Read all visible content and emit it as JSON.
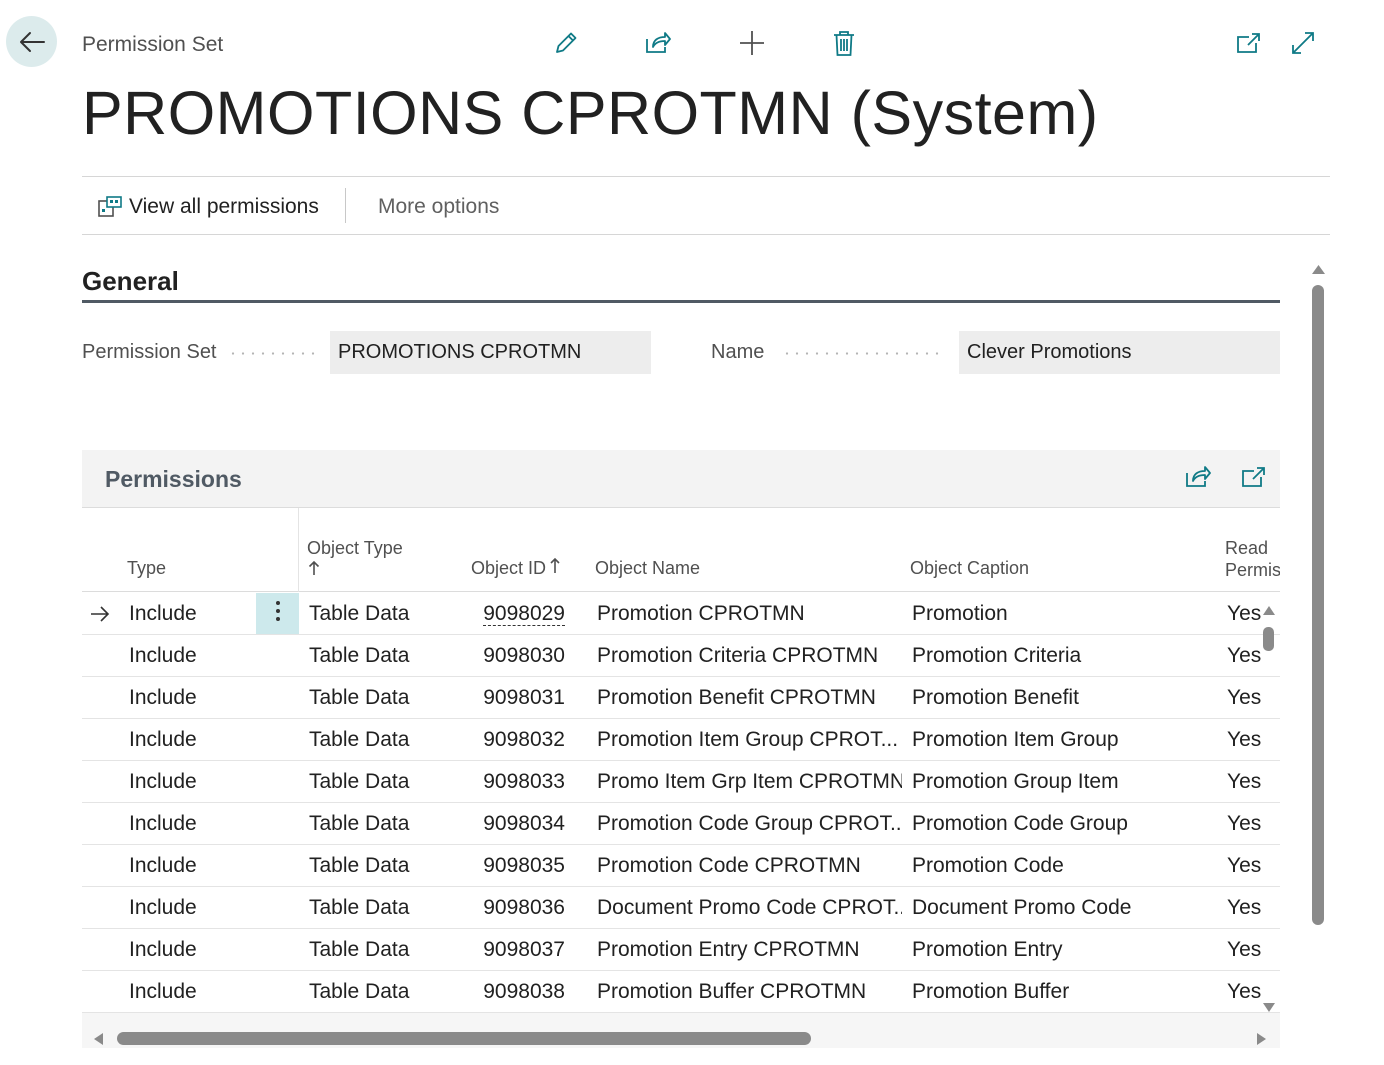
{
  "header": {
    "breadcrumb": "Permission Set",
    "title": "PROMOTIONS CPROTMN (System)"
  },
  "icons": {
    "back": "arrow-left-icon",
    "edit": "pencil-icon",
    "share": "share-icon",
    "new": "plus-icon",
    "delete": "trash-icon",
    "open_new_window": "open-in-new-window-icon",
    "expand": "expand-icon"
  },
  "actions": {
    "view_all": "View all permissions",
    "more_options": "More options"
  },
  "general": {
    "title": "General",
    "permission_set_label": "Permission Set",
    "permission_set_value": "PROMOTIONS CPROTMN",
    "name_label": "Name",
    "name_value": "Clever Promotions"
  },
  "permissions": {
    "title": "Permissions",
    "columns": {
      "type": "Type",
      "object_type": "Object Type",
      "object_id": "Object ID",
      "object_name": "Object Name",
      "object_caption": "Object Caption",
      "read_line1": "Read",
      "read_line2": "Permiss"
    },
    "rows": [
      {
        "type": "Include",
        "object_type": "Table Data",
        "object_id": "9098029",
        "object_name": "Promotion CPROTMN",
        "object_caption": "Promotion",
        "read": "Yes"
      },
      {
        "type": "Include",
        "object_type": "Table Data",
        "object_id": "9098030",
        "object_name": "Promotion Criteria CPROTMN",
        "object_caption": "Promotion Criteria",
        "read": "Yes"
      },
      {
        "type": "Include",
        "object_type": "Table Data",
        "object_id": "9098031",
        "object_name": "Promotion Benefit CPROTMN",
        "object_caption": "Promotion Benefit",
        "read": "Yes"
      },
      {
        "type": "Include",
        "object_type": "Table Data",
        "object_id": "9098032",
        "object_name": "Promotion Item Group CPROT...",
        "object_caption": "Promotion Item Group",
        "read": "Yes"
      },
      {
        "type": "Include",
        "object_type": "Table Data",
        "object_id": "9098033",
        "object_name": "Promo Item Grp Item CPROTMN",
        "object_caption": "Promotion Group Item",
        "read": "Yes"
      },
      {
        "type": "Include",
        "object_type": "Table Data",
        "object_id": "9098034",
        "object_name": "Promotion Code Group CPROT...",
        "object_caption": "Promotion Code Group",
        "read": "Yes"
      },
      {
        "type": "Include",
        "object_type": "Table Data",
        "object_id": "9098035",
        "object_name": "Promotion Code CPROTMN",
        "object_caption": "Promotion Code",
        "read": "Yes"
      },
      {
        "type": "Include",
        "object_type": "Table Data",
        "object_id": "9098036",
        "object_name": "Document Promo Code CPROT...",
        "object_caption": "Document Promo Code",
        "read": "Yes"
      },
      {
        "type": "Include",
        "object_type": "Table Data",
        "object_id": "9098037",
        "object_name": "Promotion Entry CPROTMN",
        "object_caption": "Promotion Entry",
        "read": "Yes"
      },
      {
        "type": "Include",
        "object_type": "Table Data",
        "object_id": "9098038",
        "object_name": "Promotion Buffer CPROTMN",
        "object_caption": "Promotion Buffer",
        "read": "Yes"
      }
    ]
  },
  "colors": {
    "accent": "#0f7a86",
    "selected_cell": "#cde9ec",
    "section_rule": "#505a64"
  }
}
